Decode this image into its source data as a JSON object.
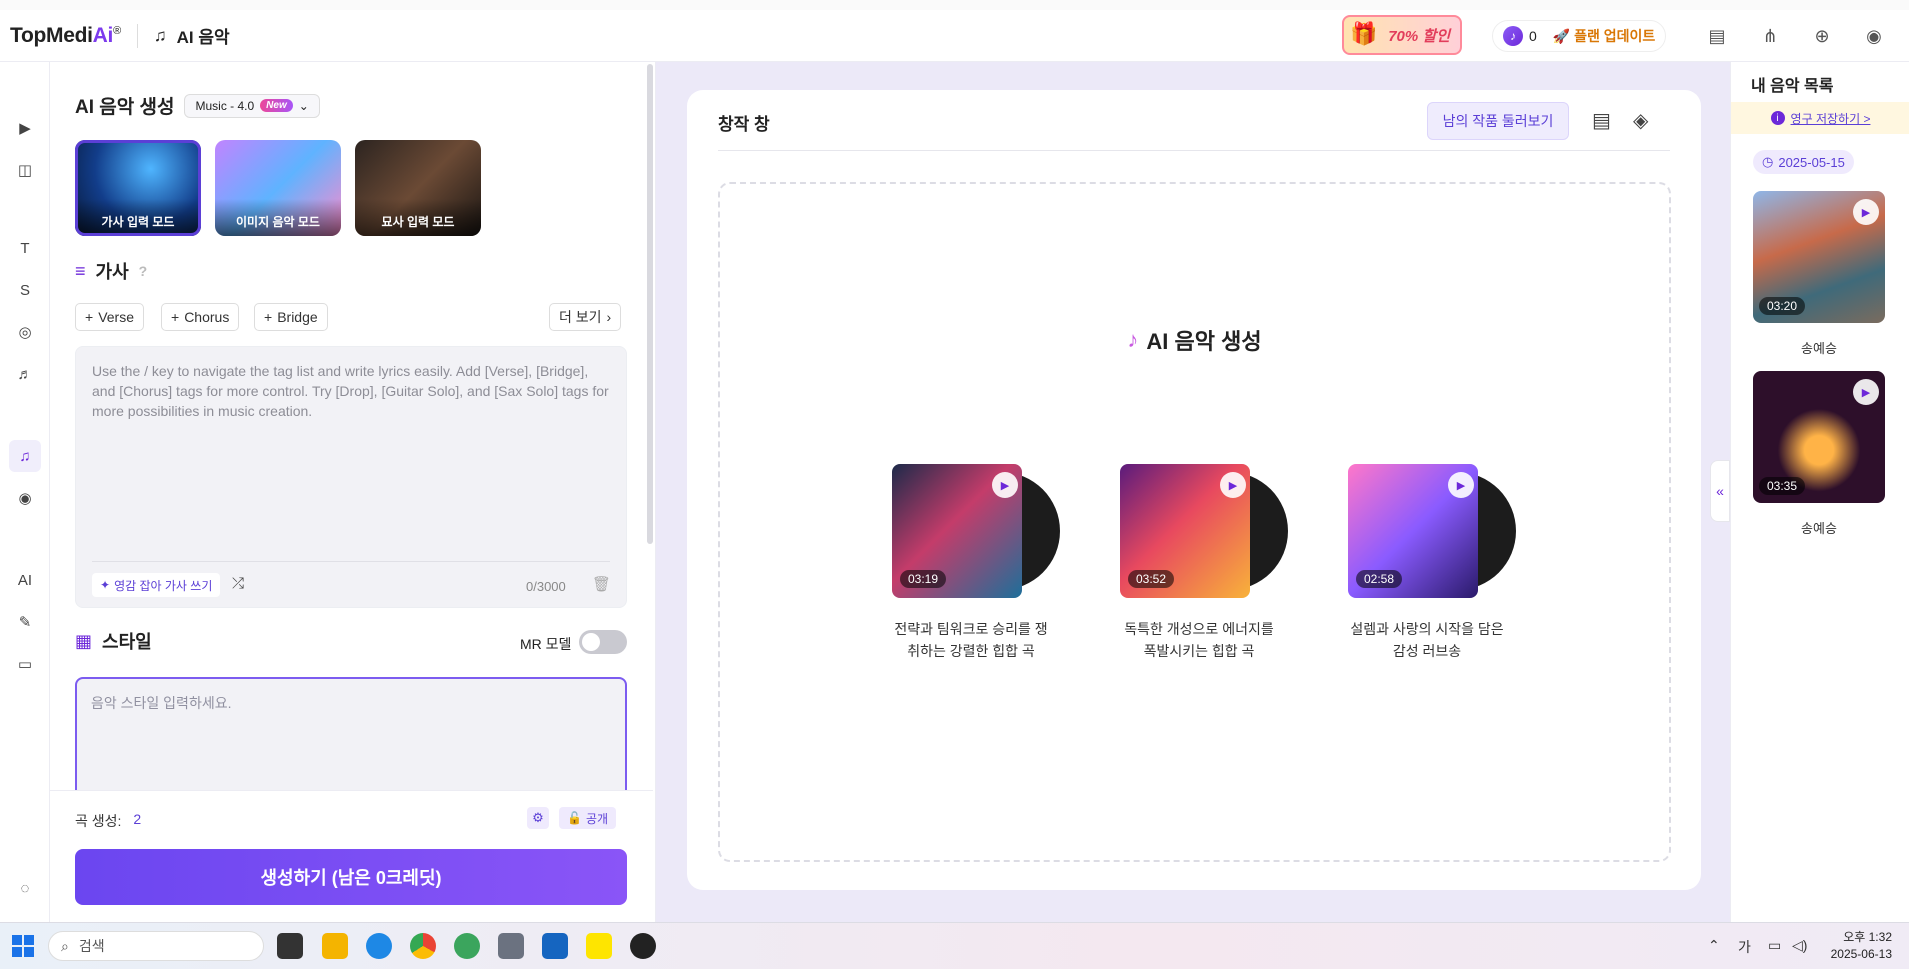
{
  "topbar": {
    "logo_main": "TopMedi",
    "logo_ai": "Ai",
    "logo_reg": "®",
    "app_title": "AI 음악",
    "promo_text": "70% 할인",
    "credits": "0",
    "upgrade_label": "플랜 업데이트"
  },
  "left": {
    "section_title": "AI 음악 생성",
    "model_label": "Music - 4.0",
    "model_badge": "New",
    "modes": [
      {
        "label": "가사 입력 모드"
      },
      {
        "label": "이미지 음악 모드"
      },
      {
        "label": "묘사 입력 모드"
      }
    ],
    "lyrics_title": "가사",
    "tags": [
      "Verse",
      "Chorus",
      "Bridge"
    ],
    "more_label": "더 보기",
    "lyrics_placeholder": "Use the / key to navigate the tag list and write lyrics easily. Add [Verse], [Bridge], and [Chorus] tags for more control. Try [Drop], [Guitar Solo], and [Sax Solo] tags for more possibilities in music creation.",
    "inspire_label": "영감 잡아 가사 쓰기",
    "char_count": "0/3000",
    "style_title": "스타일",
    "mr_label": "MR 모델",
    "mr_enabled": false,
    "style_placeholder": "음악 스타일 입력하세요.",
    "gen_count_label": "곡 생성:",
    "gen_count_value": "2",
    "public_label": "공개",
    "generate_label": "생성하기 (남은 0크레딧)"
  },
  "center": {
    "title": "창작 창",
    "browse_label": "남의 작품 둘러보기",
    "hero_title": "AI 음악 생성",
    "samples": [
      {
        "duration": "03:19",
        "caption": "전략과 팀워크로 승리를 쟁취하는 강렬한 힙합 곡"
      },
      {
        "duration": "03:52",
        "caption": "독특한 개성으로 에너지를 폭발시키는 힙합 곡"
      },
      {
        "duration": "02:58",
        "caption": "설렘과 사랑의 시작을 담은 감성 러브송"
      }
    ]
  },
  "right": {
    "title": "내 음악 목록",
    "save_label": "영구 저장하기 >",
    "date": "2025-05-15",
    "tracks": [
      {
        "duration": "03:20",
        "name": "송예승"
      },
      {
        "duration": "03:35",
        "name": "송예승"
      }
    ]
  },
  "taskbar": {
    "search_placeholder": "검색",
    "ime": "가",
    "time": "오후 1:32",
    "date": "2025-06-13"
  },
  "colors": {
    "accent": "#6b46f0",
    "accent_light": "#efeafd",
    "background": "#ece9f8"
  }
}
